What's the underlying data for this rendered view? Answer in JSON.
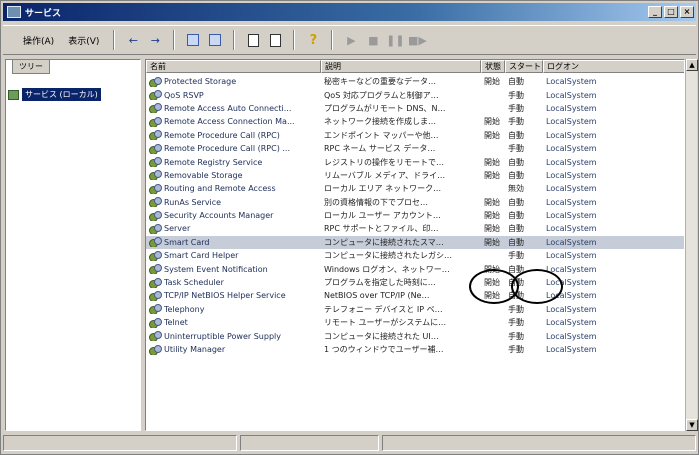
{
  "window": {
    "title": "サービス",
    "controls": [
      "_",
      "□",
      "×"
    ]
  },
  "menu": [
    {
      "label": "操作(A)"
    },
    {
      "label": "表示(V)"
    }
  ],
  "tree": {
    "tab_label": "ツリー",
    "root_label": "サービス (ローカル)"
  },
  "columns": [
    "名前",
    "説明",
    "状態",
    "スタートアップの種類",
    "ログオン"
  ],
  "services": [
    {
      "name": "Protected Storage",
      "desc": "秘密キーなどの重要なデータ…",
      "status": "開始",
      "startup": "自動",
      "logon": "LocalSystem"
    },
    {
      "name": "QoS RSVP",
      "desc": "QoS 対応プログラムと制御ア…",
      "status": "",
      "startup": "手動",
      "logon": "LocalSystem"
    },
    {
      "name": "Remote Access Auto Connecti...",
      "desc": "プログラムがリモート DNS、N…",
      "status": "",
      "startup": "手動",
      "logon": "LocalSystem"
    },
    {
      "name": "Remote Access Connection Ma...",
      "desc": "ネットワーク接続を作成しま…",
      "status": "開始",
      "startup": "手動",
      "logon": "LocalSystem"
    },
    {
      "name": "Remote Procedure Call (RPC)",
      "desc": "エンドポイント マッパーや他…",
      "status": "開始",
      "startup": "自動",
      "logon": "LocalSystem"
    },
    {
      "name": "Remote Procedure Call (RPC) ...",
      "desc": "RPC ネーム サービス データ…",
      "status": "",
      "startup": "手動",
      "logon": "LocalSystem"
    },
    {
      "name": "Remote Registry Service",
      "desc": "レジストリの操作をリモートで…",
      "status": "開始",
      "startup": "自動",
      "logon": "LocalSystem"
    },
    {
      "name": "Removable Storage",
      "desc": "リムーバブル メディア、ドライ…",
      "status": "開始",
      "startup": "自動",
      "logon": "LocalSystem"
    },
    {
      "name": "Routing and Remote Access",
      "desc": "ローカル エリア ネットワーク…",
      "status": "",
      "startup": "無効",
      "logon": "LocalSystem"
    },
    {
      "name": "RunAs Service",
      "desc": "別の資格情報の下でプロセ…",
      "status": "開始",
      "startup": "自動",
      "logon": "LocalSystem"
    },
    {
      "name": "Security Accounts Manager",
      "desc": "ローカル ユーザー アカウント…",
      "status": "開始",
      "startup": "自動",
      "logon": "LocalSystem"
    },
    {
      "name": "Server",
      "desc": "RPC サポートとファイル、印…",
      "status": "開始",
      "startup": "自動",
      "logon": "LocalSystem"
    },
    {
      "name": "Smart Card",
      "desc": "コンピュータに接続されたスマ…",
      "status": "開始",
      "startup": "自動",
      "logon": "LocalSystem"
    },
    {
      "name": "Smart Card Helper",
      "desc": "コンピュータに接続されたレガシ…",
      "status": "",
      "startup": "手動",
      "logon": "LocalSystem"
    },
    {
      "name": "System Event Notification",
      "desc": "Windows ログオン、ネットワー…",
      "status": "開始",
      "startup": "自動",
      "logon": "LocalSystem"
    },
    {
      "name": "Task Scheduler",
      "desc": "プログラムを指定した時刻に…",
      "status": "開始",
      "startup": "自動",
      "logon": "LocalSystem"
    },
    {
      "name": "TCP/IP NetBIOS Helper Service",
      "desc": "NetBIOS over TCP/IP (Ne…",
      "status": "開始",
      "startup": "自動",
      "logon": "LocalSystem"
    },
    {
      "name": "Telephony",
      "desc": "テレフォニー デバイスと IP ベ…",
      "status": "",
      "startup": "手動",
      "logon": "LocalSystem"
    },
    {
      "name": "Telnet",
      "desc": "リモート ユーザーがシステムに…",
      "status": "",
      "startup": "手動",
      "logon": "LocalSystem"
    },
    {
      "name": "Uninterruptible Power Supply",
      "desc": "コンピュータに接続された UI…",
      "status": "",
      "startup": "手動",
      "logon": "LocalSystem"
    },
    {
      "name": "Utility Manager",
      "desc": "1 つのウィンドウでユーザー補…",
      "status": "",
      "startup": "手動",
      "logon": "LocalSystem"
    }
  ],
  "selected_service": "Smart Card",
  "colors": {
    "selection": "#c6cdd8",
    "titlebar": "#0a246a"
  }
}
